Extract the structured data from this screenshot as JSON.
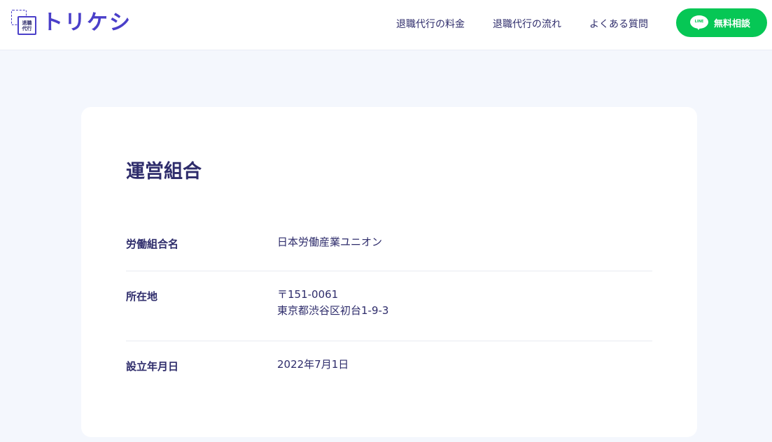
{
  "header": {
    "logo": {
      "badge_line1": "退職",
      "badge_line2": "代行",
      "text": "トリケシ"
    },
    "nav": [
      {
        "label": "退職代行の料金"
      },
      {
        "label": "退職代行の流れ"
      },
      {
        "label": "よくある質問"
      }
    ],
    "cta": {
      "icon_text": "LINE",
      "label": "無料相談"
    }
  },
  "colors": {
    "brand": "#4a3fc9",
    "text": "#2e2c6b",
    "line_green": "#06c755",
    "page_bg": "#f4f7fd"
  },
  "main": {
    "title": "運営組合",
    "rows": [
      {
        "label": "労働組合名",
        "value_lines": [
          "日本労働産業ユニオン"
        ]
      },
      {
        "label": "所在地",
        "value_lines": [
          "〒151-0061",
          "東京都渋谷区初台1-9-3"
        ]
      },
      {
        "label": "設立年月日",
        "value_lines": [
          "2022年7月1日"
        ]
      }
    ]
  }
}
